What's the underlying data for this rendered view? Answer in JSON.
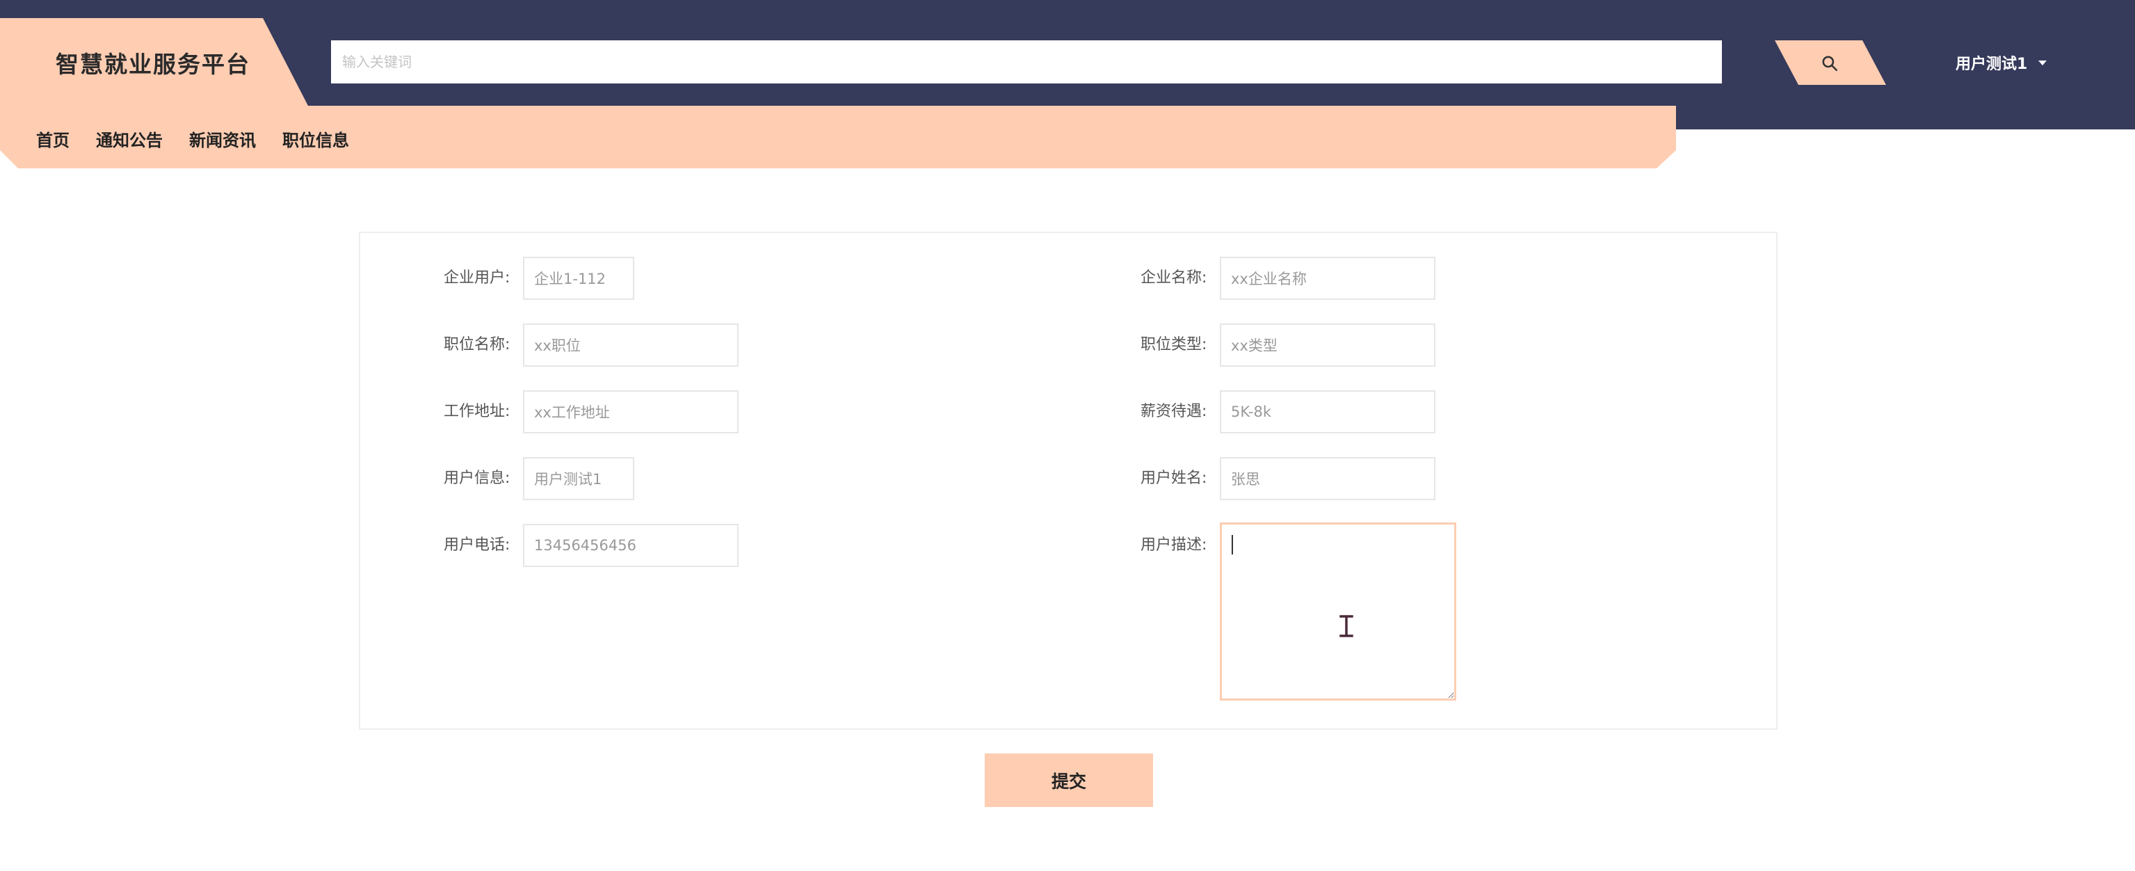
{
  "header": {
    "site_title": "智慧就业服务平台",
    "search_placeholder": "输入关键词",
    "user_menu_label": "用户测试1"
  },
  "nav": {
    "items": [
      "首页",
      "通知公告",
      "新闻资讯",
      "职位信息"
    ]
  },
  "form": {
    "company_user": {
      "label": "企业用户:",
      "value": "企业1-112"
    },
    "company_name": {
      "label": "企业名称:",
      "value": "xx企业名称"
    },
    "position_name": {
      "label": "职位名称:",
      "value": "xx职位"
    },
    "position_type": {
      "label": "职位类型:",
      "value": "xx类型"
    },
    "work_address": {
      "label": "工作地址:",
      "value": "xx工作地址"
    },
    "salary": {
      "label": "薪资待遇:",
      "value": "5K-8k"
    },
    "user_info": {
      "label": "用户信息:",
      "value": "用户测试1"
    },
    "user_name": {
      "label": "用户姓名:",
      "value": "张思"
    },
    "user_phone": {
      "label": "用户电话:",
      "value": "13456456456"
    },
    "user_desc": {
      "label": "用户描述:",
      "value": ""
    },
    "submit_label": "提交"
  },
  "colors": {
    "header_bg": "#363a5b",
    "accent": "#fecdb2",
    "border": "#e6e6e6"
  },
  "icons": {
    "search": "search-icon",
    "user_menu": "caret-down-icon"
  }
}
